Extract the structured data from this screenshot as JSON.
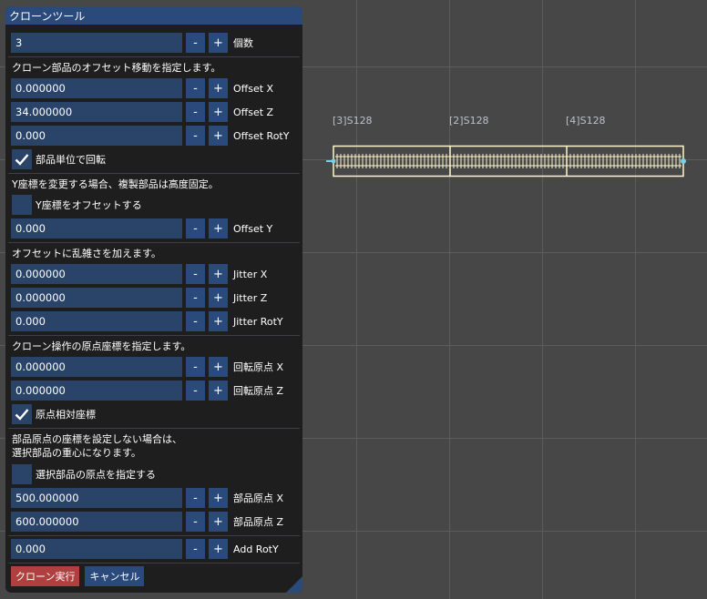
{
  "window": {
    "title": "クローンツール"
  },
  "count": {
    "value": "3",
    "label": "個数"
  },
  "offset_section": {
    "heading": "クローン部品のオフセット移動を指定します。"
  },
  "offset_x": {
    "value": "0.000000",
    "label": "Offset X"
  },
  "offset_z": {
    "value": "34.000000",
    "label": "Offset Z"
  },
  "offset_roty": {
    "value": "0.000",
    "label": "Offset RotY"
  },
  "rotate_per_part": {
    "label": "部品単位で回転",
    "checked": true
  },
  "y_section": {
    "heading": "Y座標を変更する場合、複製部品は高度固定。"
  },
  "y_offset_toggle": {
    "label": "Y座標をオフセットする",
    "checked": false
  },
  "offset_y": {
    "value": "0.000",
    "label": "Offset Y"
  },
  "jitter_section": {
    "heading": "オフセットに乱雑さを加えます。"
  },
  "jitter_x": {
    "value": "0.000000",
    "label": "Jitter X"
  },
  "jitter_z": {
    "value": "0.000000",
    "label": "Jitter Z"
  },
  "jitter_roty": {
    "value": "0.000",
    "label": "Jitter RotY"
  },
  "origin_section": {
    "heading": "クローン操作の原点座標を指定します。"
  },
  "rot_origin_x": {
    "value": "0.000000",
    "label": "回転原点 X"
  },
  "rot_origin_z": {
    "value": "0.000000",
    "label": "回転原点 Z"
  },
  "origin_relative": {
    "label": "原点相対座標",
    "checked": true
  },
  "part_origin_section": {
    "line1": "部品原点の座標を設定しない場合は、",
    "line2": "選択部品の重心になります。"
  },
  "specify_origin": {
    "label": "選択部品の原点を指定する",
    "checked": false
  },
  "part_origin_x": {
    "value": "500.000000",
    "label": "部品原点 X"
  },
  "part_origin_z": {
    "value": "600.000000",
    "label": "部品原点 Z"
  },
  "add_roty": {
    "value": "0.000",
    "label": "Add RotY"
  },
  "buttons": {
    "minus": "-",
    "plus": "+",
    "execute": "クローン実行",
    "cancel": "キャンセル"
  },
  "tracks": {
    "labels": [
      "[3]S128",
      "[2]S128",
      "[4]S128"
    ]
  },
  "colors": {
    "background": "#474747",
    "panel": "#1e1e1e",
    "title_bar": "#294a7a",
    "field": "#294369",
    "execute_button": "#b04040",
    "track": "#fff6cc",
    "track_endpoint": "#6fd3e8"
  }
}
